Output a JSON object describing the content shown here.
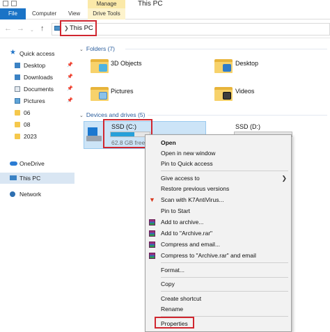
{
  "window": {
    "title": "This PC",
    "contextual_tab": "Manage"
  },
  "ribbon": {
    "tabs": [
      "File",
      "Computer",
      "View",
      "Drive Tools"
    ]
  },
  "address": {
    "crumb": "This PC",
    "nav_icons": [
      "back-arrow",
      "forward-arrow",
      "recent-chevron",
      "up-arrow"
    ]
  },
  "sidebar": {
    "quick_access": "Quick access",
    "items": [
      {
        "label": "Desktop",
        "pinned": true
      },
      {
        "label": "Downloads",
        "pinned": true
      },
      {
        "label": "Documents",
        "pinned": true
      },
      {
        "label": "Pictures",
        "pinned": true
      },
      {
        "label": "06",
        "pinned": false
      },
      {
        "label": "08",
        "pinned": false
      },
      {
        "label": "2023",
        "pinned": false
      }
    ],
    "onedrive": "OneDrive",
    "this_pc": "This PC",
    "network": "Network"
  },
  "folders": {
    "header": "Folders (7)",
    "items": [
      "3D Objects",
      "Desktop",
      "Pictures",
      "Videos"
    ]
  },
  "drives": {
    "header": "Devices and drives (5)",
    "items": [
      {
        "name": "SSD (C:)",
        "free": "62.8 GB free",
        "used_fraction": 0.6
      },
      {
        "name": "SSD (D:)",
        "free": "",
        "used_fraction": 0
      }
    ]
  },
  "context_menu": {
    "items": [
      {
        "label": "Open",
        "bold": true
      },
      {
        "label": "Open in new window"
      },
      {
        "label": "Pin to Quick access"
      },
      {
        "label": "Give access to",
        "submenu": true
      },
      {
        "label": "Restore previous versions"
      },
      {
        "label": "Scan with K7AntiVirus..."
      },
      {
        "label": "Pin to Start"
      },
      {
        "label": "Add to archive..."
      },
      {
        "label": "Add to \"Archive.rar\""
      },
      {
        "label": "Compress and email..."
      },
      {
        "label": "Compress to \"Archive.rar\" and email"
      },
      {
        "label": "Format..."
      },
      {
        "label": "Copy"
      },
      {
        "label": "Create shortcut"
      },
      {
        "label": "Rename"
      },
      {
        "label": "Properties"
      }
    ]
  },
  "colors": {
    "accent": "#1a73c6",
    "highlight_box": "#d0262f",
    "selection": "#cce4f7",
    "capacity_fill": "#26a0da"
  }
}
